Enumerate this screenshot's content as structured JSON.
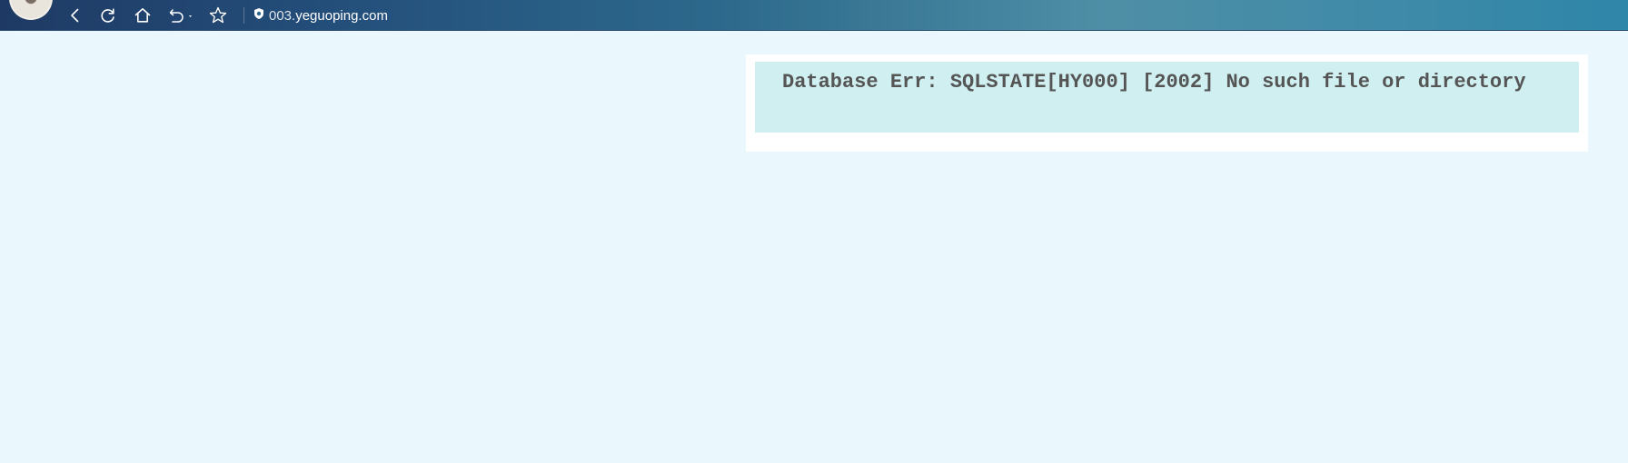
{
  "browser": {
    "address": {
      "prefix": "003.",
      "host": "yeguoping.com"
    },
    "icons": {
      "back": "back-arrow-icon",
      "reload": "reload-icon",
      "home": "home-icon",
      "undo": "undo-history-icon",
      "favorite": "star-icon",
      "secure": "shield-icon"
    }
  },
  "page": {
    "error_message": "Database Err: SQLSTATE[HY000] [2002] No such file or directory"
  },
  "colors": {
    "page_background": "#eaf7fd",
    "error_panel": "#d0eff1",
    "error_text": "#555555"
  }
}
